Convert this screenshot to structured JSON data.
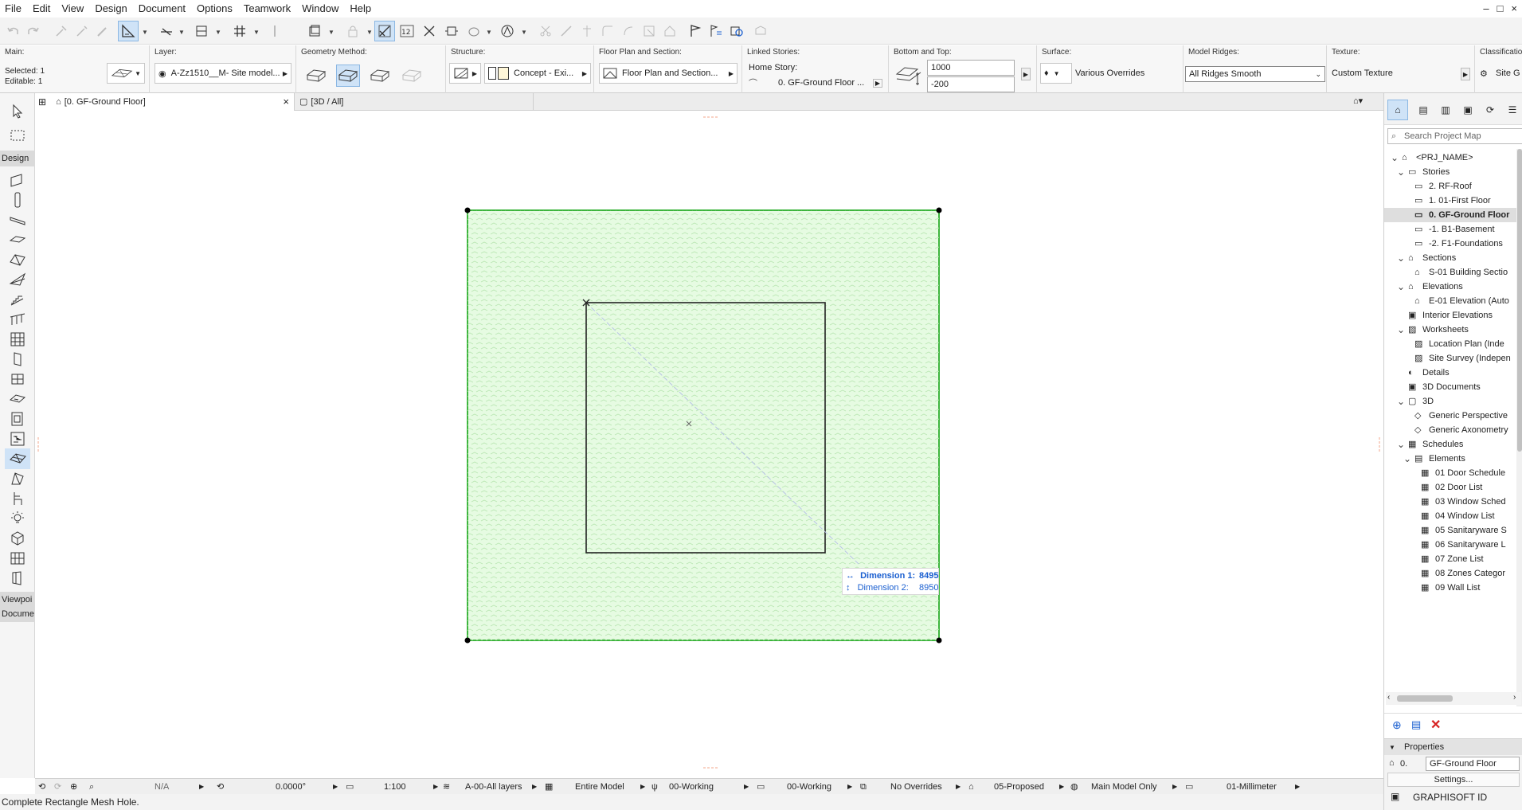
{
  "menu": [
    "File",
    "Edit",
    "View",
    "Design",
    "Document",
    "Options",
    "Teamwork",
    "Window",
    "Help"
  ],
  "window_controls": [
    "–",
    "□",
    "×"
  ],
  "infobox": {
    "main_label": "Main:",
    "selected": "Selected: 1",
    "editable": "Editable: 1",
    "layer_label": "Layer:",
    "layer_value": "A-Zz1510__M- Site model...",
    "geometry_label": "Geometry Method:",
    "structure_label": "Structure:",
    "structure_value": "Concept - Exi...",
    "floorplan_label": "Floor Plan and Section:",
    "floorplan_value": "Floor Plan and Section...",
    "linked_label": "Linked Stories:",
    "home_story_label": "Home Story:",
    "home_story_value": "0. GF-Ground Floor ...",
    "bottomtop_label": "Bottom and Top:",
    "top_value": "1000",
    "bottom_value": "-200",
    "surface_label": "Surface:",
    "surface_value": "Various Overrides",
    "ridges_label": "Model Ridges:",
    "ridges_value": "All Ridges Smooth",
    "texture_label": "Texture:",
    "texture_value": "Custom Texture",
    "classification_label": "Classification:",
    "classification_value": "Site G"
  },
  "toolbox": {
    "design_header": "Design",
    "viewpoint_header": "Viewpoi",
    "document_header": "Docume",
    "tools": [
      "arrow-tool",
      "marquee-tool",
      "wall-tool",
      "column-tool",
      "beam-tool",
      "slab-tool",
      "roof-tool",
      "shell-tool",
      "stair-tool",
      "railing-tool",
      "curtain-wall-tool",
      "door-tool",
      "window-tool",
      "skylight-tool",
      "opening-tool",
      "object-tool",
      "mesh-tool",
      "morph-tool",
      "chair-tool",
      "lamp-tool",
      "zone-tool",
      "curtain-tool",
      "wall-end-tool"
    ]
  },
  "tabs": {
    "tab1_label": "[0. GF-Ground Floor]",
    "tab1_close": "×",
    "tab2_label": "[3D / All]"
  },
  "canvas": {
    "dimension1_label": "Dimension 1:",
    "dimension1_value": "8495",
    "dimension2_label": "Dimension 2:",
    "dimension2_value": "8950",
    "mesh_fill": "#e6fbe2",
    "mesh_border": "#3db53d"
  },
  "statusbar": {
    "zoom_value": "N/A",
    "angle_value": "0.0000°",
    "scale_value": "1:100",
    "layers_value": "A-00-All layers",
    "model_value": "Entire Model",
    "pen_value": "00-Working",
    "penset_value": "00-Working",
    "override_value": "No Overrides",
    "renovation_value": "05-Proposed",
    "view_value": "Main Model Only",
    "dimension_value": "01-Millimeter"
  },
  "status_message": "Complete Rectangle Mesh Hole.",
  "navigator": {
    "search_placeholder": "Search Project Map",
    "items": [
      {
        "label": "<PRJ_NAME>",
        "level": 0,
        "twisty": "v",
        "icon": "project-icon"
      },
      {
        "label": "Stories",
        "level": 1,
        "twisty": "v",
        "icon": "folder-icon"
      },
      {
        "label": "2. RF-Roof",
        "level": 2,
        "twisty": "",
        "icon": "story-icon"
      },
      {
        "label": "1. 01-First Floor",
        "level": 2,
        "twisty": "",
        "icon": "story-icon"
      },
      {
        "label": "0. GF-Ground Floor",
        "level": 2,
        "twisty": "",
        "icon": "story-icon",
        "selected": true
      },
      {
        "label": "-1. B1-Basement",
        "level": 2,
        "twisty": "",
        "icon": "story-icon"
      },
      {
        "label": "-2. F1-Foundations",
        "level": 2,
        "twisty": "",
        "icon": "story-icon"
      },
      {
        "label": "Sections",
        "level": 1,
        "twisty": "v",
        "icon": "section-icon"
      },
      {
        "label": "S-01 Building Sectio",
        "level": 2,
        "twisty": "",
        "icon": "section-icon"
      },
      {
        "label": "Elevations",
        "level": 1,
        "twisty": "v",
        "icon": "elevation-icon"
      },
      {
        "label": "E-01 Elevation (Auto",
        "level": 2,
        "twisty": "",
        "icon": "elevation-icon"
      },
      {
        "label": "Interior Elevations",
        "level": 1,
        "twisty": "",
        "icon": "interior-elevation-icon"
      },
      {
        "label": "Worksheets",
        "level": 1,
        "twisty": "v",
        "icon": "worksheet-icon"
      },
      {
        "label": "Location Plan (Inde",
        "level": 2,
        "twisty": "",
        "icon": "worksheet-icon"
      },
      {
        "label": "Site Survey (Indepen",
        "level": 2,
        "twisty": "",
        "icon": "worksheet-icon"
      },
      {
        "label": "Details",
        "level": 1,
        "twisty": "",
        "icon": "detail-icon"
      },
      {
        "label": "3D Documents",
        "level": 1,
        "twisty": "",
        "icon": "3d-document-icon"
      },
      {
        "label": "3D",
        "level": 1,
        "twisty": "v",
        "icon": "3d-icon"
      },
      {
        "label": "Generic Perspective",
        "level": 2,
        "twisty": "",
        "icon": "perspective-icon"
      },
      {
        "label": "Generic Axonometry",
        "level": 2,
        "twisty": "",
        "icon": "axonometry-icon"
      },
      {
        "label": "Schedules",
        "level": 1,
        "twisty": "v",
        "icon": "schedule-icon"
      },
      {
        "label": "Elements",
        "level": 2,
        "twisty": "v",
        "icon": "elements-icon"
      },
      {
        "label": "01 Door Schedule",
        "level": 3,
        "twisty": "",
        "icon": "schedule-icon"
      },
      {
        "label": "02 Door List",
        "level": 3,
        "twisty": "",
        "icon": "schedule-icon"
      },
      {
        "label": "03 Window Sched",
        "level": 3,
        "twisty": "",
        "icon": "schedule-icon"
      },
      {
        "label": "04 Window List",
        "level": 3,
        "twisty": "",
        "icon": "schedule-icon"
      },
      {
        "label": "05 Sanitaryware S",
        "level": 3,
        "twisty": "",
        "icon": "schedule-icon"
      },
      {
        "label": "06 Sanitaryware L",
        "level": 3,
        "twisty": "",
        "icon": "schedule-icon"
      },
      {
        "label": "07 Zone List",
        "level": 3,
        "twisty": "",
        "icon": "schedule-icon"
      },
      {
        "label": "08 Zones Categor",
        "level": 3,
        "twisty": "",
        "icon": "schedule-icon"
      },
      {
        "label": "09 Wall List",
        "level": 3,
        "twisty": "",
        "icon": "schedule-icon"
      }
    ],
    "properties_label": "Properties",
    "properties_id": "0.",
    "properties_name": "GF-Ground Floor",
    "settings_label": "Settings...",
    "brand": "GRAPHISOFT ID"
  },
  "colors": {
    "selection": "#cfe3f7",
    "dimension_text": "#1a5fd0",
    "delete_red": "#d62020"
  }
}
